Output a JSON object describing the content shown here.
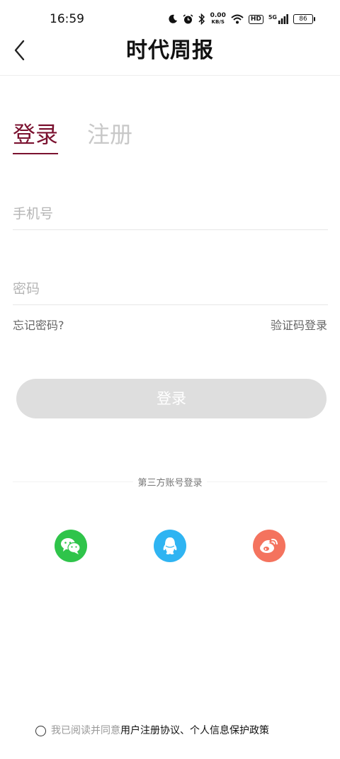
{
  "status_bar": {
    "time": "16:59",
    "speed_value": "0.00",
    "speed_unit": "KB/S",
    "hd_label": "HD",
    "network": "5G",
    "battery": "86"
  },
  "header": {
    "title": "时代周报",
    "back_icon": "chevron-left-icon"
  },
  "tabs": [
    {
      "label": "登录",
      "active": true
    },
    {
      "label": "注册",
      "active": false
    }
  ],
  "form": {
    "phone_placeholder": "手机号",
    "password_placeholder": "密码",
    "forgot_label": "忘记密码?",
    "sms_login_label": "验证码登录",
    "submit_label": "登录"
  },
  "third_party": {
    "title": "第三方账号登录",
    "providers": [
      {
        "name": "wechat",
        "icon": "wechat-icon",
        "color": "#2fc44a"
      },
      {
        "name": "qq",
        "icon": "qq-icon",
        "color": "#2fb4f2"
      },
      {
        "name": "weibo",
        "icon": "weibo-icon",
        "color": "#f4735e"
      }
    ]
  },
  "agreement": {
    "prefix": "我已阅读并同意",
    "user_agreement": "用户注册协议",
    "separator": "、",
    "privacy_policy": "个人信息保护政策"
  },
  "colors": {
    "accent": "#7b1230",
    "inactive_tab": "#c8c8c8",
    "button_disabled": "#dedede"
  }
}
